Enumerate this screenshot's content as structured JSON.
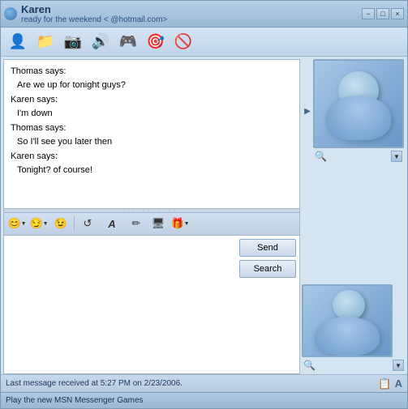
{
  "window": {
    "title": "Karen",
    "email": "@hotmail.com>",
    "status": "ready for the weekend <",
    "controls": {
      "minimize": "−",
      "maximize": "□",
      "close": "×"
    }
  },
  "toolbar": {
    "icons": [
      {
        "name": "add-contact-icon",
        "symbol": "👤"
      },
      {
        "name": "send-file-icon",
        "symbol": "📁"
      },
      {
        "name": "webcam-icon",
        "symbol": "📷"
      },
      {
        "name": "voice-chat-icon",
        "symbol": "🔊"
      },
      {
        "name": "games-icon",
        "symbol": "🎮"
      },
      {
        "name": "activities-icon",
        "symbol": "🎯"
      },
      {
        "name": "block-icon",
        "symbol": "🚫"
      }
    ]
  },
  "chat": {
    "messages": [
      {
        "sender": "Thomas says:",
        "text": "Are we up for tonight guys?"
      },
      {
        "sender": "Karen says:",
        "text": "I'm down"
      },
      {
        "sender": "Thomas says:",
        "text": "So I'll see you later then"
      },
      {
        "sender": "Karen says:",
        "text": "Tonight? of course!"
      }
    ]
  },
  "format_toolbar": {
    "icons": [
      {
        "name": "emoji-icon",
        "symbol": "😊"
      },
      {
        "name": "emotion-icon",
        "symbol": "😏"
      },
      {
        "name": "wink-icon",
        "symbol": "😉"
      },
      {
        "name": "undo-icon",
        "symbol": "↺"
      },
      {
        "name": "font-icon",
        "symbol": "A"
      },
      {
        "name": "pen-icon",
        "symbol": "✏"
      },
      {
        "name": "screen-share-icon",
        "symbol": "🖥"
      },
      {
        "name": "gift-icon",
        "symbol": "🎁"
      }
    ]
  },
  "buttons": {
    "send": "Send",
    "search": "Search"
  },
  "status_bar": {
    "text": "Last message received at 5:27 PM on 2/23/2006.",
    "icons": [
      "📋",
      "A"
    ]
  },
  "bottom_bar": {
    "text": "Play the new MSN Messenger Games"
  },
  "scrollbar": {
    "up": "▲",
    "down": "▼",
    "right_arrow": "▶"
  }
}
